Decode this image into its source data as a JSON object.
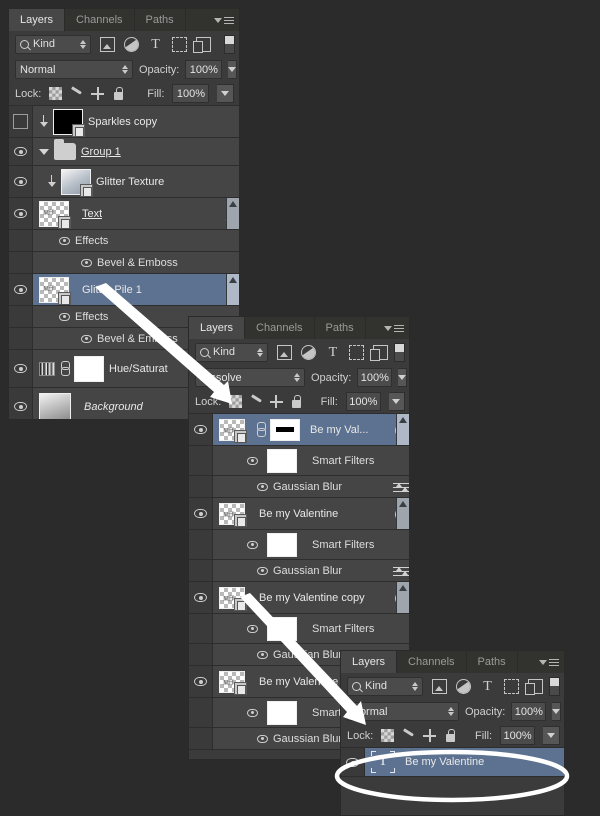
{
  "app": {
    "title": "Photoshop Layers Panel"
  },
  "panel1": {
    "tabs": [
      {
        "label": "Layers",
        "active": true
      },
      {
        "label": "Channels",
        "active": false
      },
      {
        "label": "Paths",
        "active": false
      }
    ],
    "filter": {
      "kind_label": "Kind",
      "icons": [
        "pixel-layer-icon",
        "adjustment-layer-icon",
        "type-layer-icon",
        "shape-layer-icon",
        "smart-object-icon",
        "filter-toggle-switch"
      ]
    },
    "blend": {
      "mode": "Normal",
      "opacity_label": "Opacity:",
      "opacity_value": "100%"
    },
    "lock": {
      "label": "Lock:",
      "icons": [
        "lock-transparency-icon",
        "lock-image-icon",
        "lock-position-icon",
        "lock-all-icon"
      ],
      "fill_label": "Fill:",
      "fill_value": "100%"
    },
    "rows": [
      {
        "name": "Sparkles copy",
        "visible": false,
        "thumb": "black",
        "clipped": true,
        "smart_object": true,
        "underline": false,
        "italic": false
      },
      {
        "name": "Group 1",
        "visible": true,
        "thumb": "folder",
        "group": true,
        "underline": true
      },
      {
        "name": "Glitter Texture",
        "visible": true,
        "thumb": "glitter",
        "clipped": true,
        "smart_object": true
      },
      {
        "name": "Text",
        "visible": true,
        "thumb": "checker",
        "fx": "fx",
        "underline": true,
        "scrollbar": true
      },
      {
        "name": "Effects",
        "visible": true,
        "indent": 1,
        "sub": true
      },
      {
        "name": "Bevel & Emboss",
        "visible": true,
        "indent": 2,
        "sub": true
      },
      {
        "name": "Glitter Pile 1",
        "visible": true,
        "thumb": "checker",
        "fx": "fx",
        "selected": true,
        "scrollbar": true
      },
      {
        "name": "Effects",
        "visible": true,
        "indent": 1,
        "sub": true
      },
      {
        "name": "Bevel & Emboss",
        "visible": true,
        "indent": 2,
        "sub": true
      },
      {
        "name": "Hue/Saturat",
        "visible": true,
        "thumb": "adjustment",
        "mask": "white",
        "link": true
      },
      {
        "name": "Background",
        "visible": true,
        "thumb": "gradient",
        "italic": true
      }
    ]
  },
  "panel2": {
    "tabs": [
      {
        "label": "Layers",
        "active": true
      },
      {
        "label": "Channels",
        "active": false
      },
      {
        "label": "Paths",
        "active": false
      }
    ],
    "filter": {
      "kind_label": "Kind"
    },
    "blend": {
      "mode": "Dissolve",
      "opacity_label": "Opacity:",
      "opacity_value": "100%"
    },
    "lock": {
      "label": "Lock:",
      "fill_label": "Fill:",
      "fill_value": "100%"
    },
    "rows": [
      {
        "name": "Be my Val...",
        "visible": true,
        "thumb": "checker",
        "link": true,
        "mask": "bar",
        "smart_object_badge": true,
        "selected": true,
        "scrollbar": true
      },
      {
        "name": "Smart Filters",
        "visible": true,
        "indent": 1,
        "mask_thumb": true,
        "sub": true
      },
      {
        "name": "Gaussian Blur",
        "visible": true,
        "indent": 2,
        "filter_settings": true,
        "sub": true
      },
      {
        "name": "Be my Valentine",
        "visible": true,
        "thumb": "checker",
        "smart_object_badge": true,
        "scrollbar": true
      },
      {
        "name": "Smart Filters",
        "visible": true,
        "indent": 1,
        "mask_thumb": true,
        "sub": true
      },
      {
        "name": "Gaussian Blur",
        "visible": true,
        "indent": 2,
        "filter_settings": true,
        "sub": true
      },
      {
        "name": "Be my Valentine copy",
        "visible": true,
        "thumb": "checker",
        "smart_object_badge": true,
        "scrollbar": true
      },
      {
        "name": "Smart Filters",
        "visible": true,
        "indent": 1,
        "mask_thumb": true,
        "sub": true
      },
      {
        "name": "Gaussian Blur",
        "visible": true,
        "indent": 2,
        "filter_settings": true,
        "sub": true
      },
      {
        "name": "Be my Valentine c",
        "visible": true,
        "thumb": "checker",
        "smart_object_badge": true
      },
      {
        "name": "Smart",
        "visible": true,
        "indent": 1,
        "mask_thumb": true,
        "sub": true
      },
      {
        "name": "Gaussian Blur",
        "visible": true,
        "indent": 2,
        "sub": true
      }
    ]
  },
  "panel3": {
    "tabs": [
      {
        "label": "Layers",
        "active": true
      },
      {
        "label": "Channels",
        "active": false
      },
      {
        "label": "Paths",
        "active": false
      }
    ],
    "filter": {
      "kind_label": "Kind"
    },
    "blend": {
      "mode": "Normal",
      "opacity_label": "Opacity:",
      "opacity_value": "100%"
    },
    "lock": {
      "label": "Lock:",
      "fill_label": "Fill:",
      "fill_value": "100%"
    },
    "rows": [
      {
        "name": "Be my Valentine",
        "visible": true,
        "thumb": "type",
        "selected": true
      }
    ]
  },
  "annotations": {
    "highlight_ellipse": "white-ellipse-highlight",
    "arrow_1": "arrow-glitter-pile-to-panel2",
    "arrow_2": "arrow-valentine-to-panel3"
  },
  "colors": {
    "panel_bg": "#3b3b3b",
    "row_bg": "#454545",
    "selected_row": "#5c7290",
    "tab_active": "#474747",
    "text": "#e8e8e8",
    "canvas_bg": "#2b2b2b",
    "annotation": "#ffffff"
  }
}
